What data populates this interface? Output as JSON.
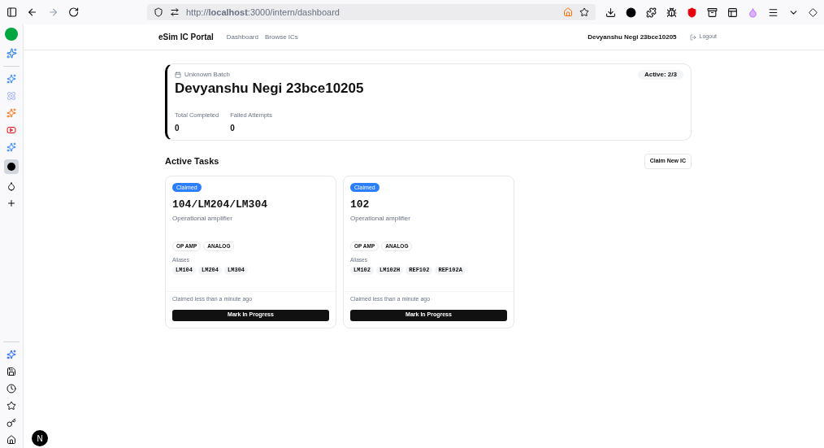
{
  "browser": {
    "url": "http://**localhost**:3000/intern/dashboard"
  },
  "header": {
    "brand": "eSim IC Portal",
    "nav": [
      {
        "label": "Dashboard",
        "selected": false
      },
      {
        "label": "Browse ICs",
        "selected": false
      }
    ],
    "user": "Devyanshu Negi 23bce10205",
    "logout": "Logout"
  },
  "profile": {
    "batch": "Unknown Batch",
    "name": "Devyanshu Negi 23bce10205",
    "active_badge": "Active: 2/3",
    "stats": [
      {
        "label": "Total Completed",
        "value": "0"
      },
      {
        "label": "Failed Attempts",
        "value": "0"
      }
    ]
  },
  "section": {
    "title": "Active Tasks",
    "button": "Claim New IC"
  },
  "tasks": [
    {
      "status": "Claimed",
      "part": "104/LM204/LM304",
      "description": "Operational amplifier",
      "tags": [
        "OP AMP",
        "ANALOG"
      ],
      "aliases_label": "Aliases",
      "aliases": [
        "LM104",
        "LM204",
        "LM304"
      ],
      "claimed_time": "Claimed less than a minute ago",
      "action": "Mark In Progress"
    },
    {
      "status": "Claimed",
      "part": "102",
      "description": "Operational amplifier",
      "tags": [
        "OP AMP",
        "ANALOG"
      ],
      "aliases_label": "Aliases",
      "aliases": [
        "LM102",
        "LM102H",
        "REF102",
        "REF102A"
      ],
      "claimed_time": "Claimed less than a minute ago",
      "action": "Mark In Progress"
    }
  ],
  "dev_badge": "N"
}
